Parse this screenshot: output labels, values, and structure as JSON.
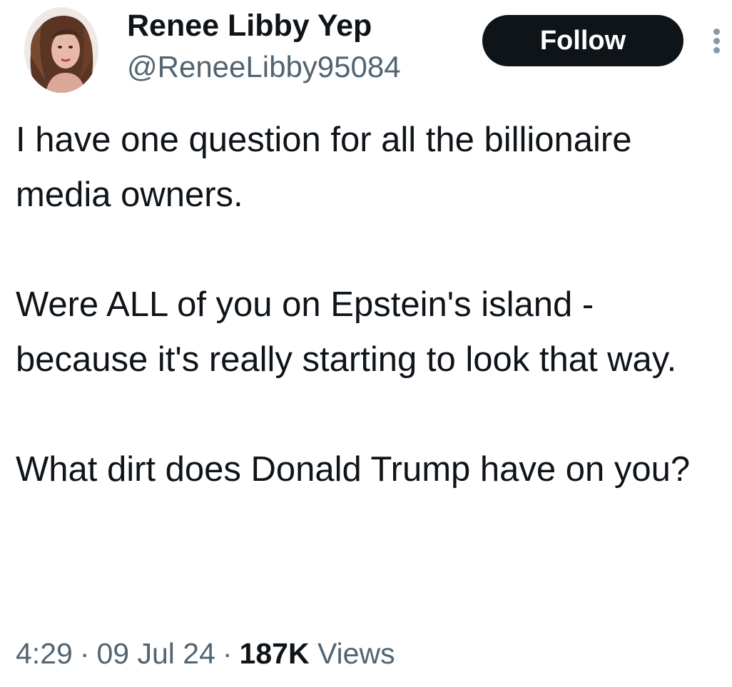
{
  "author": {
    "display_name": "Renee Libby Yep",
    "handle": "@ReneeLibby95084"
  },
  "actions": {
    "follow_label": "Follow",
    "more_icon": "more-vertical-icon"
  },
  "tweet": {
    "paragraphs": [
      "I have one question for all the billionaire media owners.",
      "Were ALL of you on Epstein's island -because it's really starting to  look that way.",
      "What dirt does Donald Trump have on you?"
    ]
  },
  "meta": {
    "time": "4:29",
    "date": "09 Jul 24",
    "separator": "·",
    "views_count": "187K",
    "views_label": "Views"
  },
  "colors": {
    "text_primary": "#0f1419",
    "text_secondary": "#536471",
    "follow_button_bg": "#0f1419",
    "follow_button_text": "#ffffff",
    "background": "#ffffff"
  }
}
